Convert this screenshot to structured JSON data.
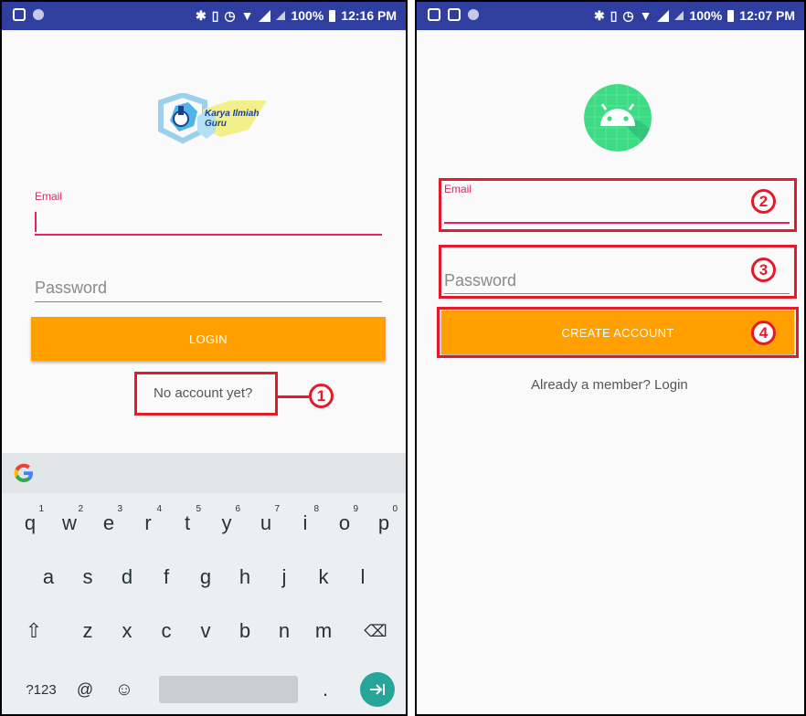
{
  "left_screen": {
    "status_bar": {
      "battery": "100%",
      "time": "12:16 PM"
    },
    "logo": {
      "line1": "Karya Ilmiah",
      "line2": "Guru"
    },
    "email_label": "Email",
    "password_hint": "Password",
    "login_button": "LOGIN",
    "register_link": "No account yet?",
    "annotation": "1",
    "keyboard": {
      "row1": [
        "q",
        "w",
        "e",
        "r",
        "t",
        "y",
        "u",
        "i",
        "o",
        "p"
      ],
      "row1_numbers": [
        "1",
        "2",
        "3",
        "4",
        "5",
        "6",
        "7",
        "8",
        "9",
        "0"
      ],
      "row2": [
        "a",
        "s",
        "d",
        "f",
        "g",
        "h",
        "j",
        "k",
        "l"
      ],
      "row3": [
        "z",
        "x",
        "c",
        "v",
        "b",
        "n",
        "m"
      ],
      "symbols_key": "?123",
      "at_key": "@",
      "period_key": "."
    }
  },
  "right_screen": {
    "status_bar": {
      "battery": "100%",
      "time": "12:07 PM"
    },
    "email_label": "Email",
    "password_hint": "Password",
    "create_button": "CREATE ACCOUNT",
    "login_link": "Already a member? Login",
    "annotations": [
      "2",
      "3",
      "4"
    ]
  },
  "colors": {
    "status_bar": "#303f9f",
    "accent": "#e91e63",
    "button": "#ffa000",
    "annotation_red": "#e41a2a",
    "android_logo": "#3ddc84"
  }
}
